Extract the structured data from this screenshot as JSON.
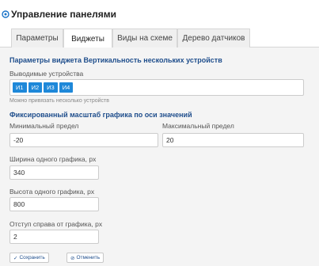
{
  "header": {
    "title": "Управление панелями"
  },
  "tabs": [
    {
      "label": "Параметры"
    },
    {
      "label": "Виджеты"
    },
    {
      "label": "Виды на схеме"
    },
    {
      "label": "Дерево датчиков"
    }
  ],
  "active_tab": "Виджеты",
  "panel": {
    "title": "Параметры виджета Вертикальность нескольких устройств",
    "devices_label": "Выводимые устройства",
    "devices": [
      "И1",
      "И2",
      "И3",
      "И4"
    ],
    "devices_hint": "Можно привязать несколько устройств",
    "scale_section": "Фиксированный масштаб графика по оси значений",
    "min_label": "Минимальный предел",
    "min_value": "-20",
    "max_label": "Максимальный предел",
    "max_value": "20",
    "width_label": "Ширина одного графика, px",
    "width_value": "340",
    "height_label": "Высота одного графика, px",
    "height_value": "800",
    "offset_label": "Отступ справа от графика, px",
    "offset_value": "2"
  },
  "buttons": {
    "save": "Сохранить",
    "cancel": "Отменить"
  },
  "colors": {
    "accent": "#1e88d9",
    "heading": "#1f4e8c"
  }
}
